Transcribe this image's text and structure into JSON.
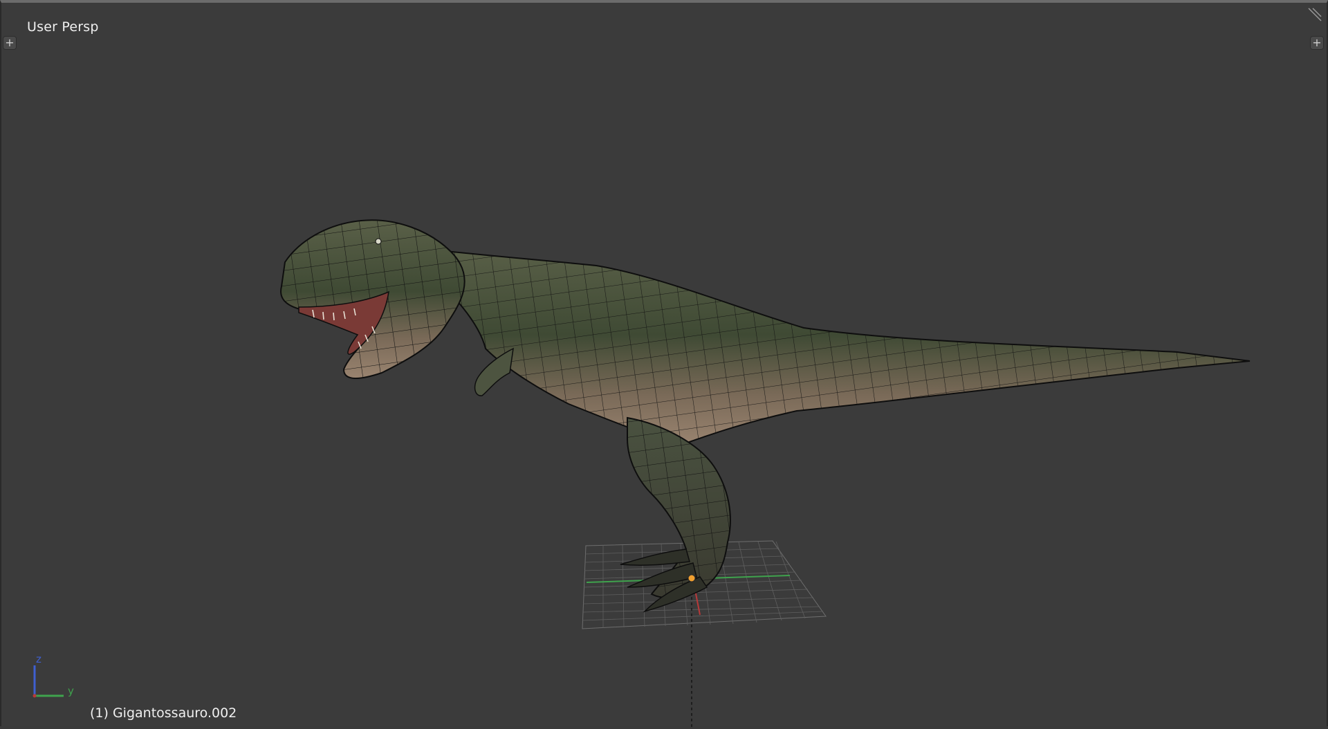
{
  "viewport": {
    "view_name": "User Persp",
    "object_info": "(1) Gigantossauro.002",
    "axis_labels": {
      "z": "z",
      "y": "y"
    },
    "corner_widget_icon": "plus-icon",
    "corner_widget_glyph": "+"
  },
  "colors": {
    "background": "#3b3b3b",
    "grid": "#6e6e6e",
    "y_axis": "#3fa34d",
    "x_axis": "#b83a3a",
    "z_axis": "#3f5fd0",
    "origin": "#f0a030",
    "wire": "#111111"
  }
}
